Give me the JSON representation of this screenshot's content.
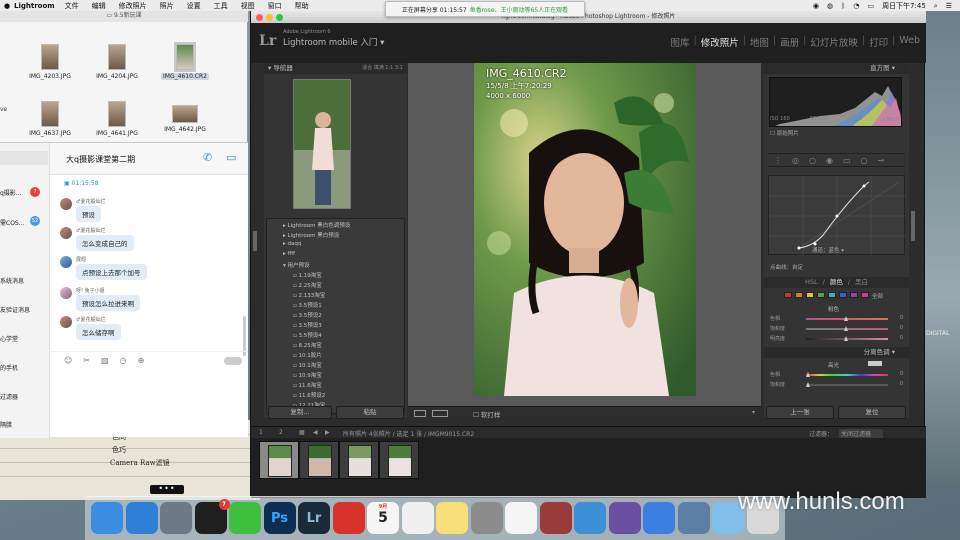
{
  "menubar": {
    "app": "Lightroom",
    "items": [
      "文件",
      "编辑",
      "修改照片",
      "照片",
      "设置",
      "工具",
      "视图",
      "窗口",
      "帮助"
    ],
    "clock": "周日下午7:45"
  },
  "share_banner": {
    "prefix": "正在屏幕分享 01:15:57",
    "viewers": "鱼香rose、王小丽动等65人正在观看"
  },
  "finder": {
    "title": "9.5新玩课",
    "files": [
      {
        "name": "IMG_4203.JPG"
      },
      {
        "name": "IMG_4204.JPG"
      },
      {
        "name": "IMG_4610.CR2"
      },
      {
        "name": "IMG_4637.JPG"
      },
      {
        "name": "IMG_4641.JPG"
      },
      {
        "name": "IMG_4642.JPG"
      }
    ],
    "side_label": "ve"
  },
  "qq": {
    "title": "大q摄影课堂第二期",
    "contacts": [
      {
        "label": "q摄影...",
        "badge": "7"
      },
      {
        "label": "需COS...",
        "badge": "52"
      },
      {
        "label": "系统消息",
        "badge": ""
      },
      {
        "label": "友验证消息",
        "badge": ""
      },
      {
        "label": "心学堂",
        "badge": ""
      },
      {
        "label": "的手机",
        "badge": ""
      },
      {
        "label": "过滤器",
        "badge": ""
      },
      {
        "label": "隔腊",
        "badge": ""
      }
    ],
    "time": "01:15:58",
    "messages": [
      {
        "name": "♂夏花般灿烂",
        "text": "预设"
      },
      {
        "name": "♂夏花般灿烂",
        "text": "怎么变成自己的"
      },
      {
        "name": "展翅",
        "text": "点预设上去那个加号"
      },
      {
        "name": "呀! 兔子小姐",
        "text": "预设怎么拉进来啊"
      },
      {
        "name": "♂夏花般灿烂",
        "text": "怎么储存啊"
      }
    ]
  },
  "desk_notes": [
    "色同",
    "色巧",
    "Camera Raw滤镜"
  ],
  "lightroom": {
    "window_title": "Adobe Photoshop Lightroom - 修改照片",
    "window_title_prefix": "lightroom.catalog -",
    "product_small": "Adobe Lightroom 6",
    "product": "Lightroom mobile 入门",
    "modules": [
      "图库",
      "修改照片",
      "地图",
      "画册",
      "幻灯片放映",
      "打印",
      "Web"
    ],
    "active_module": "修改照片",
    "navigator": {
      "title": "导航器",
      "zoom_options": "适合  填满  1:1  3:1"
    },
    "presets": [
      {
        "label": "Lightroom 黑白色调预设",
        "type": "folder"
      },
      {
        "label": "Lightroom 黑白预设",
        "type": "folder"
      },
      {
        "label": "daqq",
        "type": "folder"
      },
      {
        "label": "ffff",
        "type": "folder"
      },
      {
        "label": "用户预设",
        "type": "folder-open"
      },
      {
        "label": "1.19淘宝",
        "type": "item"
      },
      {
        "label": "2.25淘宝",
        "type": "item"
      },
      {
        "label": "2.133淘宝",
        "type": "item"
      },
      {
        "label": "3.5预设1",
        "type": "item"
      },
      {
        "label": "3.5预设2",
        "type": "item"
      },
      {
        "label": "3.5预设3",
        "type": "item"
      },
      {
        "label": "3.5预设4",
        "type": "item"
      },
      {
        "label": "8.25淘宝",
        "type": "item"
      },
      {
        "label": "10.1胶片",
        "type": "item"
      },
      {
        "label": "10.1淘宝",
        "type": "item"
      },
      {
        "label": "10.9淘宝",
        "type": "item"
      },
      {
        "label": "11.6淘宝",
        "type": "item"
      },
      {
        "label": "11.6预设2",
        "type": "item"
      },
      {
        "label": "12.21淘宝",
        "type": "item"
      }
    ],
    "copy_btn": "复制...",
    "paste_btn": "粘贴",
    "photo": {
      "filename": "IMG_4610.CR2",
      "datetime": "15/5/8 上午7:20:29",
      "dimensions": "4000 x 6000"
    },
    "softproof": "软打样",
    "histogram": {
      "title": "直方图",
      "iso": "ISO 160",
      "focal": "50 mm",
      "aperture": "f / 1.8",
      "shutter": "1/80 秒",
      "original": "原始照片"
    },
    "curve": {
      "channel_label": "通道：",
      "channel_value": "蓝色",
      "point_curve": "点曲线：自定"
    },
    "hsl_tabs": [
      "HSL",
      "颜色",
      "黑白"
    ],
    "hsl_active": "颜色",
    "hsl_all": "全部",
    "hsl_swatch_colors": [
      "#c0392b",
      "#e07b2b",
      "#e3c53b",
      "#4fa544",
      "#3fb1b5",
      "#3b5fc4",
      "#8e44ad",
      "#c63c8e"
    ],
    "color_section": {
      "title": "粉色",
      "rows": [
        {
          "label": "色相",
          "value": "0"
        },
        {
          "label": "饱和度",
          "value": "0"
        },
        {
          "label": "明亮度",
          "value": "0"
        }
      ]
    },
    "split_tone": {
      "title": "分离色调",
      "highlight": "高光",
      "rows": [
        {
          "label": "色相",
          "value": "0"
        },
        {
          "label": "饱和度",
          "value": "0"
        }
      ]
    },
    "prev_btn": "上一张",
    "reset_btn": "复位",
    "filmstrip": {
      "source": "所有照片    4张照片 / 选定 1 张 / IMGM9015.CR2",
      "filter_label": "过滤器：",
      "filter_value": "关闭过滤器",
      "page_nums": [
        "1",
        "2"
      ]
    }
  },
  "dock": {
    "icons": [
      {
        "name": "finder",
        "color": "#3a8de0"
      },
      {
        "name": "safari",
        "color": "#2f7fd8"
      },
      {
        "name": "launchpad",
        "color": "#6d7a86"
      },
      {
        "name": "qq",
        "color": "#1f1f1f",
        "badge": "7"
      },
      {
        "name": "wechat",
        "color": "#3fbf3f"
      },
      {
        "name": "photoshop",
        "color": "#0d2d52",
        "glyph": "Ps"
      },
      {
        "name": "lightroom",
        "color": "#1b2a38",
        "glyph": "Lr"
      },
      {
        "name": "netease-music",
        "color": "#d7332b"
      },
      {
        "name": "calendar",
        "color": "#f5f5f5",
        "glyph": "5",
        "month": "9月"
      },
      {
        "name": "reminders",
        "color": "#f0f0f0"
      },
      {
        "name": "notes",
        "color": "#f7e07a"
      },
      {
        "name": "system-preferences",
        "color": "#8c8c8c"
      },
      {
        "name": "photos",
        "color": "#f5f5f5"
      },
      {
        "name": "photo-booth",
        "color": "#9a3b3b"
      },
      {
        "name": "xcode-bird",
        "color": "#3d8fd6"
      },
      {
        "name": "video-player",
        "color": "#6b4fa0"
      },
      {
        "name": "baidu-cloud",
        "color": "#3b7fe0"
      },
      {
        "name": "preview",
        "color": "#5c7fa6"
      },
      {
        "name": "folder",
        "color": "#7fbfe8"
      },
      {
        "name": "trash",
        "color": "#d9d9d9"
      }
    ]
  },
  "watermark": "www.hunls.com",
  "desktop_label": "DIGITAL"
}
